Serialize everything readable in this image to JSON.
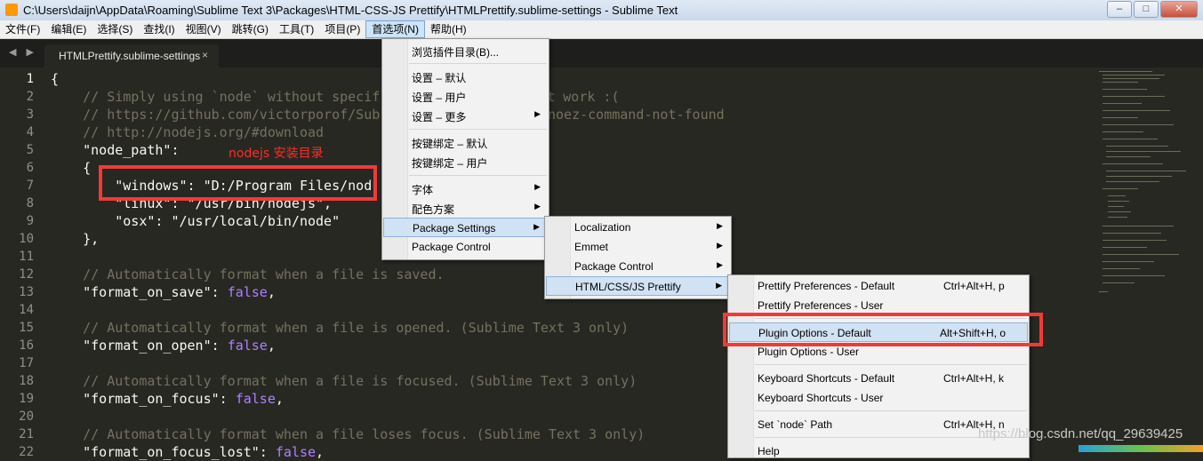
{
  "window": {
    "title": "C:\\Users\\daijn\\AppData\\Roaming\\Sublime Text 3\\Packages\\HTML-CSS-JS Prettify\\HTMLPrettify.sublime-settings - Sublime Text",
    "buttons": {
      "minimize": "–",
      "maximize": "□",
      "close": "✕"
    }
  },
  "menubar": {
    "items": [
      "文件(F)",
      "编辑(E)",
      "选择(S)",
      "查找(I)",
      "视图(V)",
      "跳转(G)",
      "工具(T)",
      "项目(P)",
      "首选项(N)",
      "帮助(H)"
    ],
    "active_index": 8
  },
  "tab": {
    "title": "HTMLPrettify.sublime-settings",
    "close": "×",
    "nav_arrows": "◀ ▶"
  },
  "editor": {
    "line_numbers": [
      "1",
      "2",
      "3",
      "4",
      "5",
      "6",
      "7",
      "8",
      "9",
      "10",
      "11",
      "12",
      "13",
      "14",
      "15",
      "16",
      "17",
      "18",
      "19",
      "20",
      "21",
      "22"
    ],
    "lines": [
      "{",
      "    // Simply using `node` without specif",
      "    // https://github.com/victorporof/Sub",
      "    // http://nodejs.org/#download",
      "    \"node_path\":",
      "    {",
      "        \"windows\": \"D:/Program Files/nod",
      "        \"linux\": \"/usr/bin/nodejs\",",
      "        \"osx\": \"/usr/local/bin/node\"",
      "    },",
      "",
      "    // Automatically format when a file is saved.",
      "    \"format_on_save\": false,",
      "",
      "    // Automatically format when a file is opened. (Sublime Text 3 only)",
      "    \"format_on_open\": false,",
      "",
      "    // Automatically format when a file is focused. (Sublime Text 3 only)",
      "    \"format_on_focus\": false,",
      "",
      "    // Automatically format when a file loses focus. (Sublime Text 3 only)",
      "    \"format_on_focus_lost\": false,"
    ],
    "line2_tail": " doesn't work :(",
    "line3_tail": "noez-command-not-found",
    "annotation": "nodejs 安装目录"
  },
  "menu_preferences": {
    "items": [
      {
        "label": "浏览插件目录(B)..."
      },
      {
        "label": "设置 – 默认"
      },
      {
        "label": "设置 – 用户"
      },
      {
        "label": "设置 – 更多",
        "submenu": true
      },
      {
        "label": "按键绑定 – 默认"
      },
      {
        "label": "按键绑定 – 用户"
      },
      {
        "label": "字体",
        "submenu": true
      },
      {
        "label": "配色方案",
        "submenu": true
      },
      {
        "label": "Package Settings",
        "submenu": true
      },
      {
        "label": "Package Control"
      }
    ]
  },
  "menu_package_settings": {
    "items": [
      {
        "label": "Localization",
        "submenu": true
      },
      {
        "label": "Emmet",
        "submenu": true
      },
      {
        "label": "Package Control",
        "submenu": true
      },
      {
        "label": "HTML/CSS/JS Prettify",
        "submenu": true
      }
    ]
  },
  "menu_prettify": {
    "items": [
      {
        "label": "Prettify Preferences - Default",
        "shortcut": "Ctrl+Alt+H, p"
      },
      {
        "label": "Prettify Preferences - User",
        "shortcut": ""
      },
      {
        "label": "Plugin Options - Default",
        "shortcut": "Alt+Shift+H, o"
      },
      {
        "label": "Plugin Options - User",
        "shortcut": ""
      },
      {
        "label": "Keyboard Shortcuts - Default",
        "shortcut": "Ctrl+Alt+H, k"
      },
      {
        "label": "Keyboard Shortcuts - User",
        "shortcut": ""
      },
      {
        "label": "Set `node` Path",
        "shortcut": "Ctrl+Alt+H, n"
      },
      {
        "label": "Help",
        "shortcut": ""
      }
    ]
  },
  "watermark": "https://blog.csdn.net/qq_29639425",
  "colors": {
    "editor_bg": "#272822",
    "comment": "#75715e",
    "constant": "#ae81ff",
    "highlight_box": "#f03a3a"
  }
}
